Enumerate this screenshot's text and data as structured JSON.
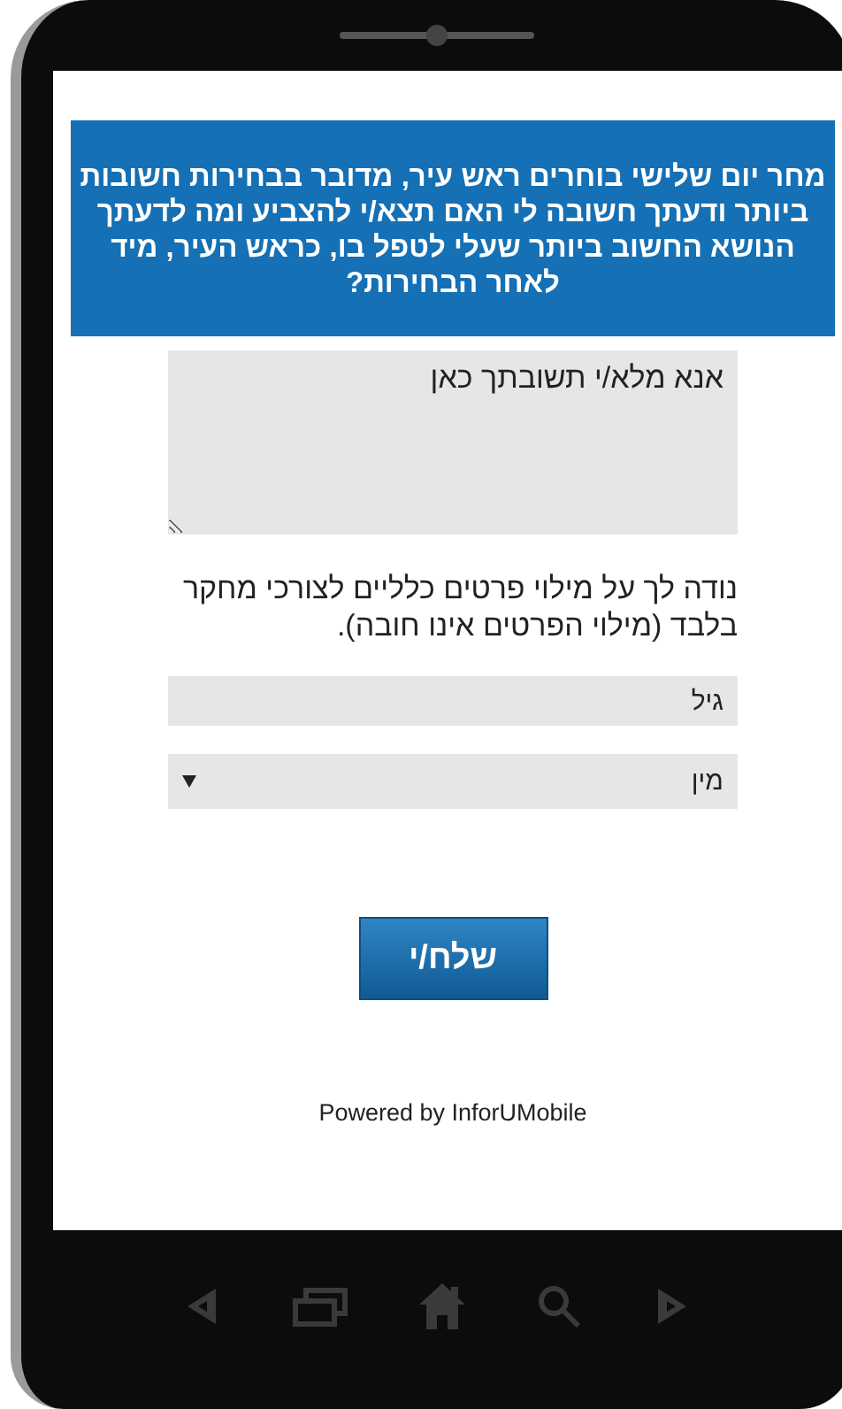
{
  "question": {
    "text": "מחר יום שלישי בוחרים ראש עיר, מדובר בבחירות חשובות ביותר ודעתך חשובה לי האם תצא/י להצביע ומה לדעתך הנושא החשוב ביותר שעלי לטפל בו, כראש העיר, מיד לאחר הבחירות?"
  },
  "answer_field": {
    "placeholder": "אנא מלא/י תשובתך כאן"
  },
  "note": "נודה לך על מילוי פרטים כלליים לצורכי מחקר בלבד (מילוי הפרטים אינו חובה).",
  "age_field": {
    "placeholder": "גיל"
  },
  "gender_dropdown": {
    "value": "מין"
  },
  "submit_button": "שלח/י",
  "footer": "Powered by InforUMobile",
  "nav_buttons": [
    {
      "kind": "back"
    },
    {
      "kind": "recent"
    },
    {
      "kind": "home"
    },
    {
      "kind": "search"
    },
    {
      "kind": "forward"
    }
  ]
}
